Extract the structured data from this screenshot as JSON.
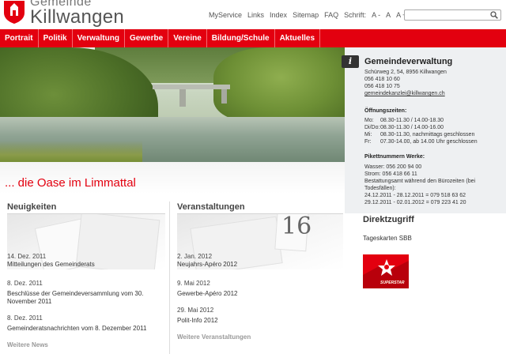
{
  "brand": {
    "top": "Gemeinde",
    "name": "Killwangen"
  },
  "toplinks": {
    "myservice": "MyService",
    "links": "Links",
    "index": "Index",
    "sitemap": "Sitemap",
    "faq": "FAQ",
    "font_label": "Schrift:",
    "font_small": "A -",
    "font_normal": "A",
    "font_large": "A +"
  },
  "search": {
    "placeholder": "",
    "icon": "search-icon"
  },
  "nav": [
    "Portrait",
    "Politik",
    "Verwaltung",
    "Gewerbe",
    "Vereine",
    "Bildung/Schule",
    "Aktuelles"
  ],
  "tagline": "... die Oase im Limmattal",
  "info": {
    "badge": "i",
    "title": "Gemeindeverwaltung",
    "address": "Schürweg 2, 54, 8956 Killwangen",
    "phone": "056 418 10 60",
    "fax": "056 418 10 75",
    "email": "gemeindekanzlei@killwangen.ch",
    "hours_title": "Öffnungszeiten:",
    "hours": [
      {
        "day": "Mo:",
        "time": "08.30-11.30 / 14.00-18.30"
      },
      {
        "day": "Di/Do:",
        "time": "08.30-11.30 / 14.00-16.00"
      },
      {
        "day": "Mi:",
        "time": "08.30-11.30, nachmittags geschlossen"
      },
      {
        "day": "Fr:",
        "time": "07.30-14.00, ab 14.00 Uhr geschlossen"
      }
    ],
    "pikett_title": "Pikettnummern Werke:",
    "pikett": [
      "Wasser: 056 200 94 00",
      "Strom: 056 418 66 11",
      "Bestattungsamt während den Bürozeiten (bei",
      "Todesfällen):",
      "24.12.2011 - 28.12.2011 = 079 518 63 62",
      "29.12.2011 - 02.01.2012 = 079 223 41 20"
    ]
  },
  "direktzugriff": {
    "title": "Direktzugriff",
    "link": "Tageskarten SBB",
    "logo_text": "SUPERSTAR"
  },
  "news": {
    "title": "Neuigkeiten",
    "items": [
      {
        "date": "14. Dez. 2011",
        "text": "Mitteilungen des Gemeinderats"
      },
      {
        "date": "8. Dez. 2011",
        "text": "Beschlüsse der Gemeindeversammlung vom 30.",
        "text2": "November 2011"
      },
      {
        "date": "8. Dez. 2011",
        "text": "Gemeinderatsnachrichten vom 8. Dezember 2011"
      }
    ],
    "more": "Weitere News"
  },
  "events": {
    "title": "Veranstaltungen",
    "bignum": "16",
    "items": [
      {
        "date": "2. Jan. 2012",
        "text": "Neujahrs-Apéro 2012"
      },
      {
        "date": "9. Mai 2012",
        "text": "Gewerbe-Apéro 2012"
      },
      {
        "date": "29. Mai 2012",
        "text": "Polit-Info 2012"
      }
    ],
    "more": "Weitere Veranstaltungen"
  }
}
